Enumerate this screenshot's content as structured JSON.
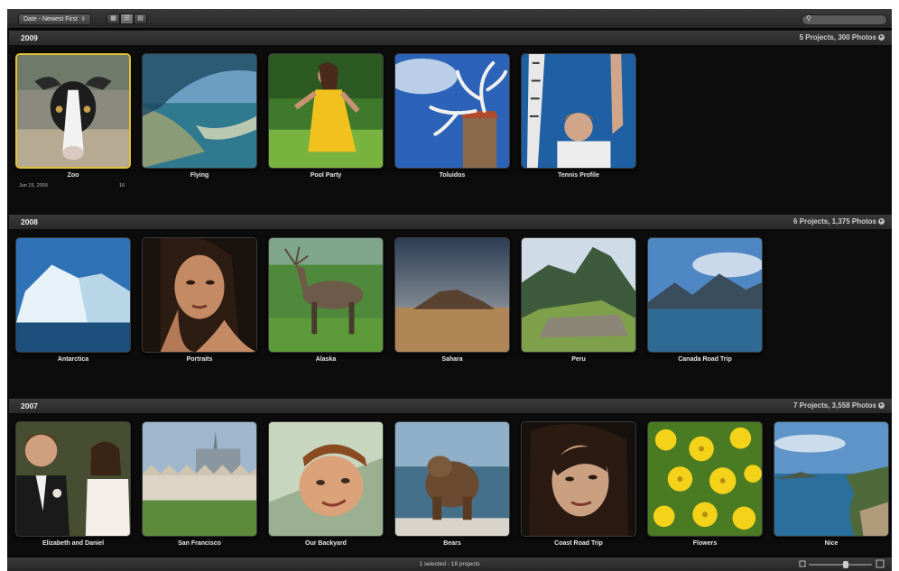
{
  "toolbar": {
    "sort_label": "Date - Newest First",
    "sort_chevron": "⇕",
    "view_buttons": [
      "grid-view-icon",
      "list-view-icon",
      "browser-view-icon"
    ],
    "search_icon": "search-icon"
  },
  "sections": [
    {
      "year": "2009",
      "count": "5 Projects, 300 Photos",
      "projects": [
        {
          "name": "Zoo",
          "date": "Jun 15, 2009",
          "photos": "16",
          "selected": true
        },
        {
          "name": "Flying"
        },
        {
          "name": "Pool Party"
        },
        {
          "name": "Toluidos"
        },
        {
          "name": "Tennis Profile"
        }
      ]
    },
    {
      "year": "2008",
      "count": "6 Projects, 1,375 Photos",
      "projects": [
        {
          "name": "Antarctica"
        },
        {
          "name": "Portraits"
        },
        {
          "name": "Alaska"
        },
        {
          "name": "Sahara"
        },
        {
          "name": "Peru"
        },
        {
          "name": "Canada Road Trip"
        }
      ]
    },
    {
      "year": "2007",
      "count": "7 Projects, 3,558 Photos",
      "projects": [
        {
          "name": "Elizabeth and Daniel"
        },
        {
          "name": "San Francisco"
        },
        {
          "name": "Our Backyard"
        },
        {
          "name": "Bears"
        },
        {
          "name": "Coast Road Trip"
        },
        {
          "name": "Flowers"
        },
        {
          "name": "Nice"
        }
      ]
    }
  ],
  "status": {
    "text": "1 selected - 18 projects"
  },
  "colors": {
    "selection": "#e2c233",
    "background": "#0c0c0c",
    "bar": "#2f2f2f"
  }
}
